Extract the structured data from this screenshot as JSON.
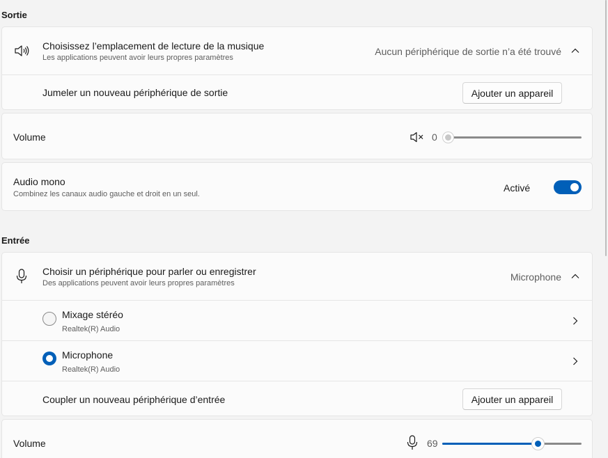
{
  "output": {
    "section_title": "Sortie",
    "location": {
      "title": "Choisissez l’emplacement de lecture de la musique",
      "subtitle": "Les applications peuvent avoir leurs propres paramètres",
      "status": "Aucun périphérique de sortie n’a été trouvé",
      "icon": "speaker-icon"
    },
    "pair": {
      "title": "Jumeler un nouveau périphérique de sortie",
      "button_label": "Ajouter un appareil"
    },
    "volume": {
      "label": "Volume",
      "value": "0",
      "level": 0,
      "icon": "speaker-muted-icon"
    },
    "mono": {
      "title": "Audio mono",
      "subtitle": "Combinez les canaux audio gauche et droit en un seul.",
      "state_label": "Activé",
      "enabled": true
    }
  },
  "input": {
    "section_title": "Entrée",
    "device_choice": {
      "title": "Choisir un périphérique pour parler ou enregistrer",
      "subtitle": "Des applications peuvent avoir leurs propres paramètres",
      "selected": "Microphone",
      "icon": "microphone-icon"
    },
    "devices": [
      {
        "name": "Mixage stéréo",
        "driver": "Realtek(R) Audio",
        "selected": false
      },
      {
        "name": "Microphone",
        "driver": "Realtek(R) Audio",
        "selected": true
      }
    ],
    "pair": {
      "title": "Coupler un nouveau périphérique d’entrée",
      "button_label": "Ajouter un appareil"
    },
    "volume": {
      "label": "Volume",
      "value": "69",
      "level": 69,
      "icon": "microphone-icon"
    }
  },
  "colors": {
    "accent": "#005fb8",
    "track_off": "#8a8a8a",
    "text_secondary": "#5d5d5d"
  }
}
